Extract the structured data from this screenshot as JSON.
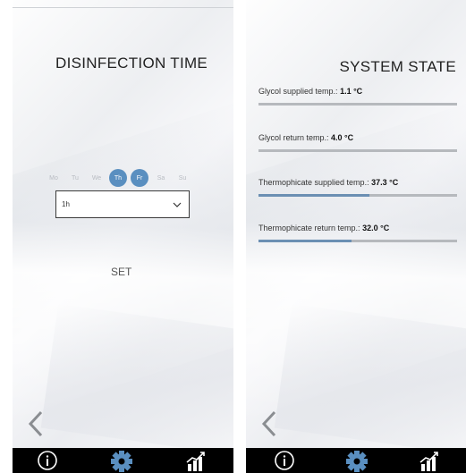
{
  "left_panel": {
    "title": "DISINFECTION TIME",
    "days": [
      {
        "label": "Mo",
        "selected": false
      },
      {
        "label": "Tu",
        "selected": false
      },
      {
        "label": "We",
        "selected": false
      },
      {
        "label": "Th",
        "selected": true
      },
      {
        "label": "Fr",
        "selected": true
      },
      {
        "label": "Sa",
        "selected": false
      },
      {
        "label": "Su",
        "selected": false
      }
    ],
    "time_select_value": "1h",
    "set_label": "SET"
  },
  "right_panel": {
    "title": "SYSTEM STATE",
    "rows": [
      {
        "label": "Glycol supplied temp.:",
        "value": "1.1 °C",
        "level_percent": 0
      },
      {
        "label": "Glycol return temp.:",
        "value": "4.0 °C",
        "level_percent": 0
      },
      {
        "label": "Thermophicate supplied temp.:",
        "value": "37.3 °C",
        "level_percent": 56
      },
      {
        "label": "Thermophicate return temp.:",
        "value": "32.0 °C",
        "level_percent": 47
      }
    ]
  },
  "bottom_nav": {
    "icons": [
      "info-icon",
      "gear-icon",
      "stats-icon"
    ],
    "active_color": "#5a8fc0"
  },
  "colors": {
    "accent": "#5a8fc0",
    "bar_track": "#b6b9bd",
    "bar_fill": "#6b8fb3"
  }
}
